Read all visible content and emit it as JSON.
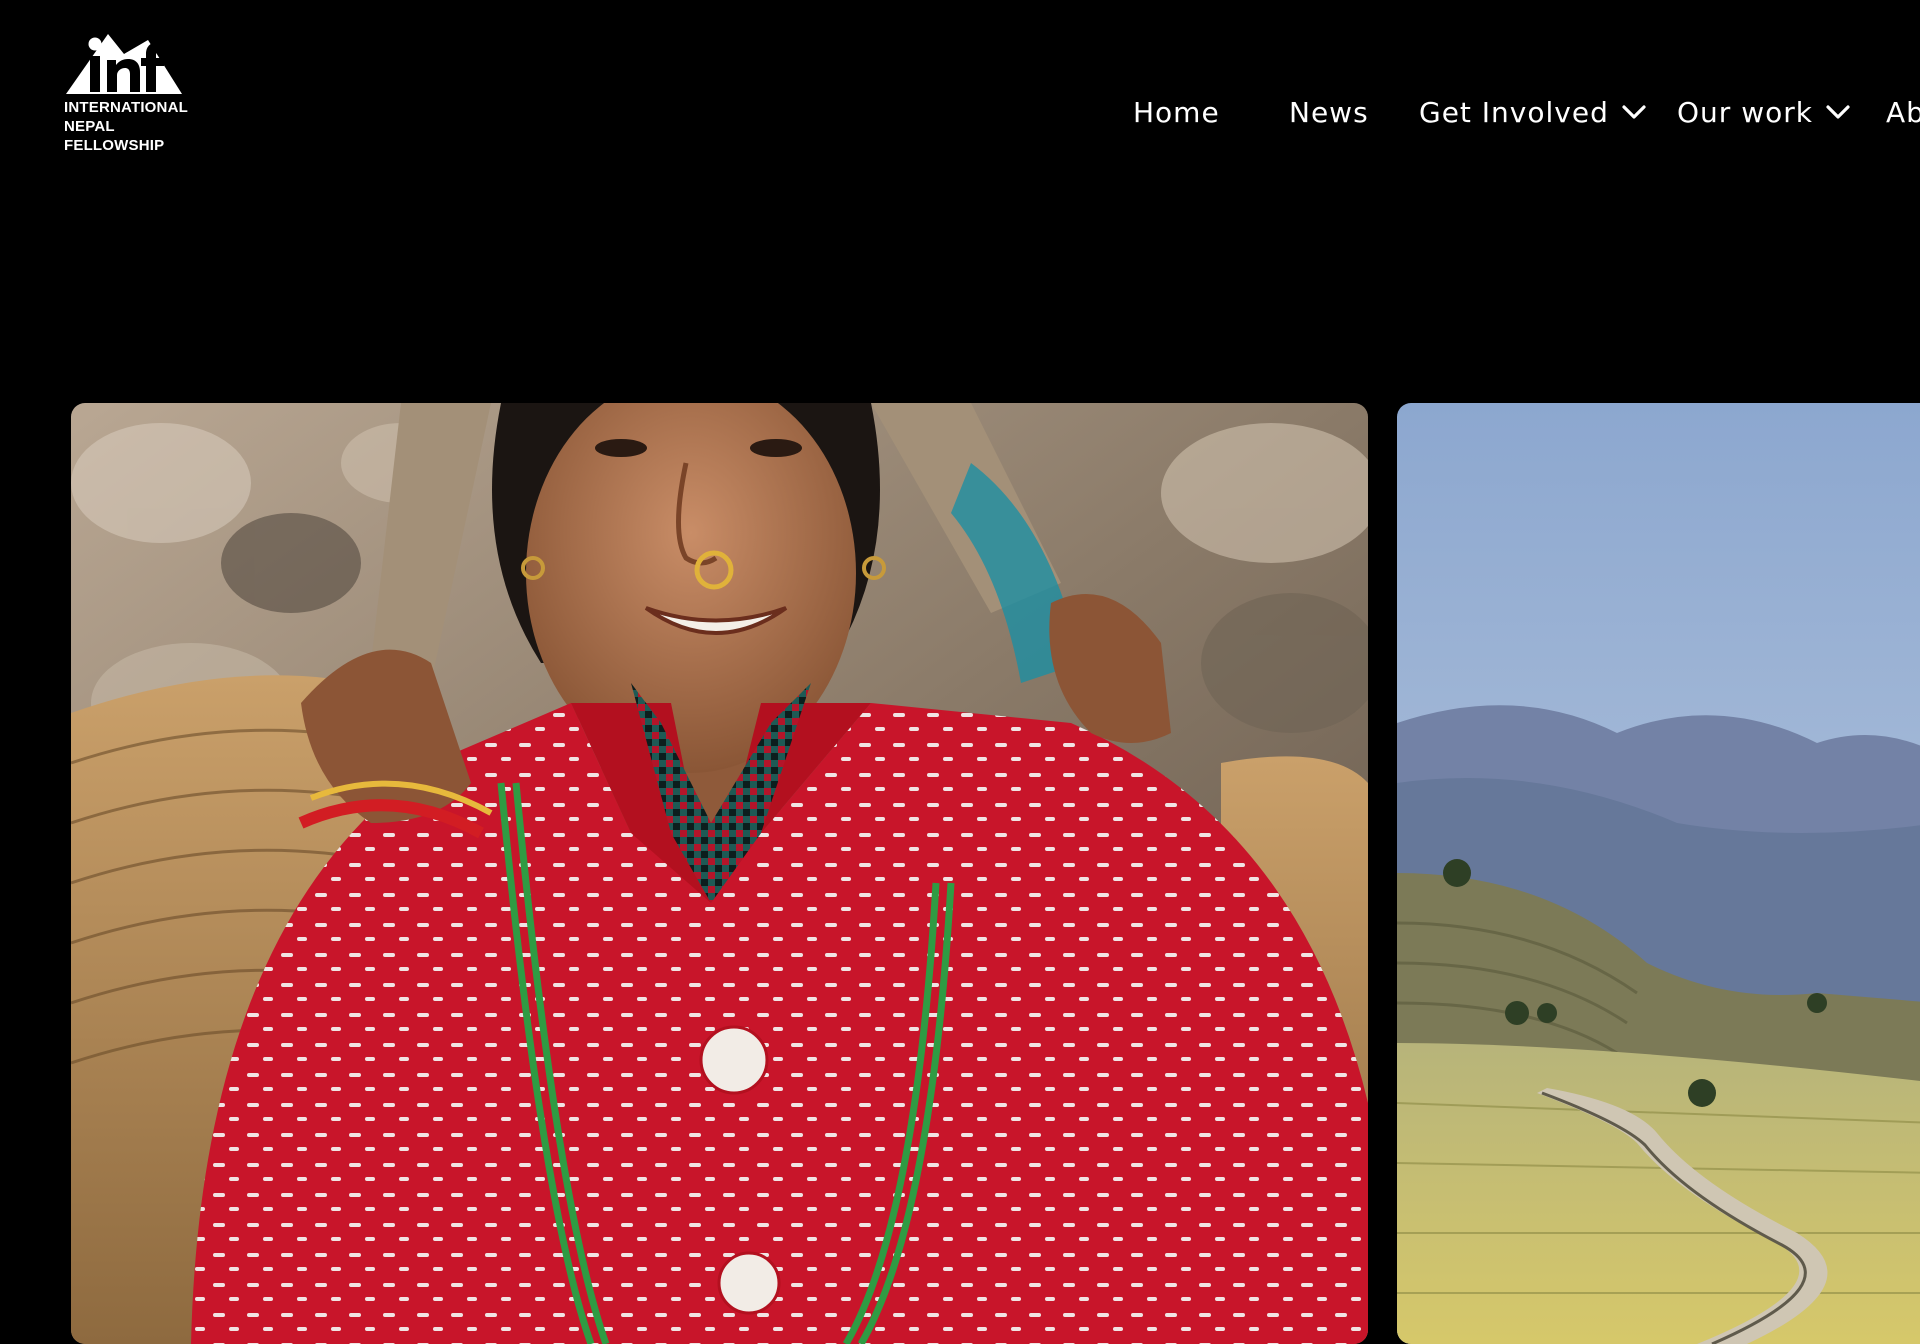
{
  "logo": {
    "icon": "inf-mountain-logo-icon",
    "line1": "INTERNATIONAL",
    "line2": "NEPAL",
    "line3": "FELLOWSHIP"
  },
  "nav": {
    "home": "Home",
    "news": "News",
    "get_involved": "Get Involved",
    "our_work": "Our work",
    "about": "Ab",
    "dropdown_icon": "chevron-down-icon"
  },
  "cards": [
    {
      "image": "woman-with-basket-photo"
    },
    {
      "image": "mountain-valley-terraces-photo"
    }
  ],
  "colors": {
    "background": "#000000",
    "text": "#ffffff"
  }
}
